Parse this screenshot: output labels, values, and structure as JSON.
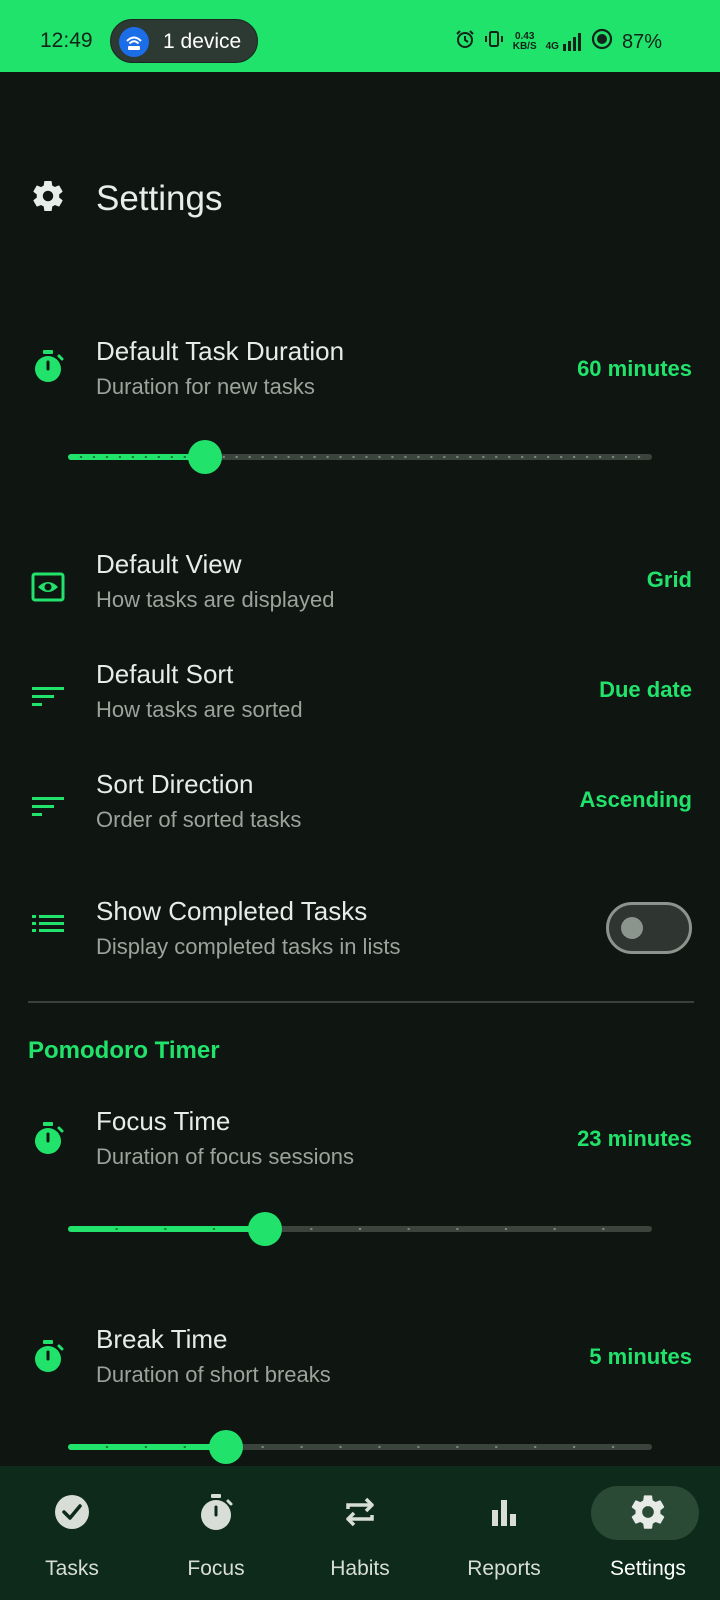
{
  "status_bar": {
    "time": "12:49",
    "device_pill": "1 device",
    "net_speed_value": "0.43",
    "net_speed_unit": "KB/S",
    "network_type": "4G",
    "battery": "87%"
  },
  "header": {
    "title": "Settings"
  },
  "settings": {
    "task_duration": {
      "title": "Default Task Duration",
      "subtitle": "Duration for new tasks",
      "value": "60 minutes",
      "slider_fraction": 0.235
    },
    "default_view": {
      "title": "Default View",
      "subtitle": "How tasks are displayed",
      "value": "Grid"
    },
    "default_sort": {
      "title": "Default Sort",
      "subtitle": "How tasks are sorted",
      "value": "Due date"
    },
    "sort_direction": {
      "title": "Sort Direction",
      "subtitle": "Order of sorted tasks",
      "value": "Ascending"
    },
    "show_completed": {
      "title": "Show Completed Tasks",
      "subtitle": "Display completed tasks in lists",
      "enabled": false
    }
  },
  "pomodoro": {
    "section_title": "Pomodoro Timer",
    "focus_time": {
      "title": "Focus Time",
      "subtitle": "Duration of focus sessions",
      "value": "23 minutes",
      "slider_fraction": 0.337
    },
    "break_time": {
      "title": "Break Time",
      "subtitle": "Duration of short breaks",
      "value": "5 minutes",
      "slider_fraction": 0.27
    }
  },
  "bottom_nav": {
    "items": [
      {
        "label": "Tasks",
        "icon": "check-circle-icon"
      },
      {
        "label": "Focus",
        "icon": "timer-icon"
      },
      {
        "label": "Habits",
        "icon": "repeat-icon"
      },
      {
        "label": "Reports",
        "icon": "bar-chart-icon"
      },
      {
        "label": "Settings",
        "icon": "gear-icon",
        "active": true
      }
    ]
  },
  "colors": {
    "accent": "#21e36c",
    "background": "#0f1511",
    "status_bar": "#1fe36a",
    "nav_background": "#0d2a1a"
  }
}
